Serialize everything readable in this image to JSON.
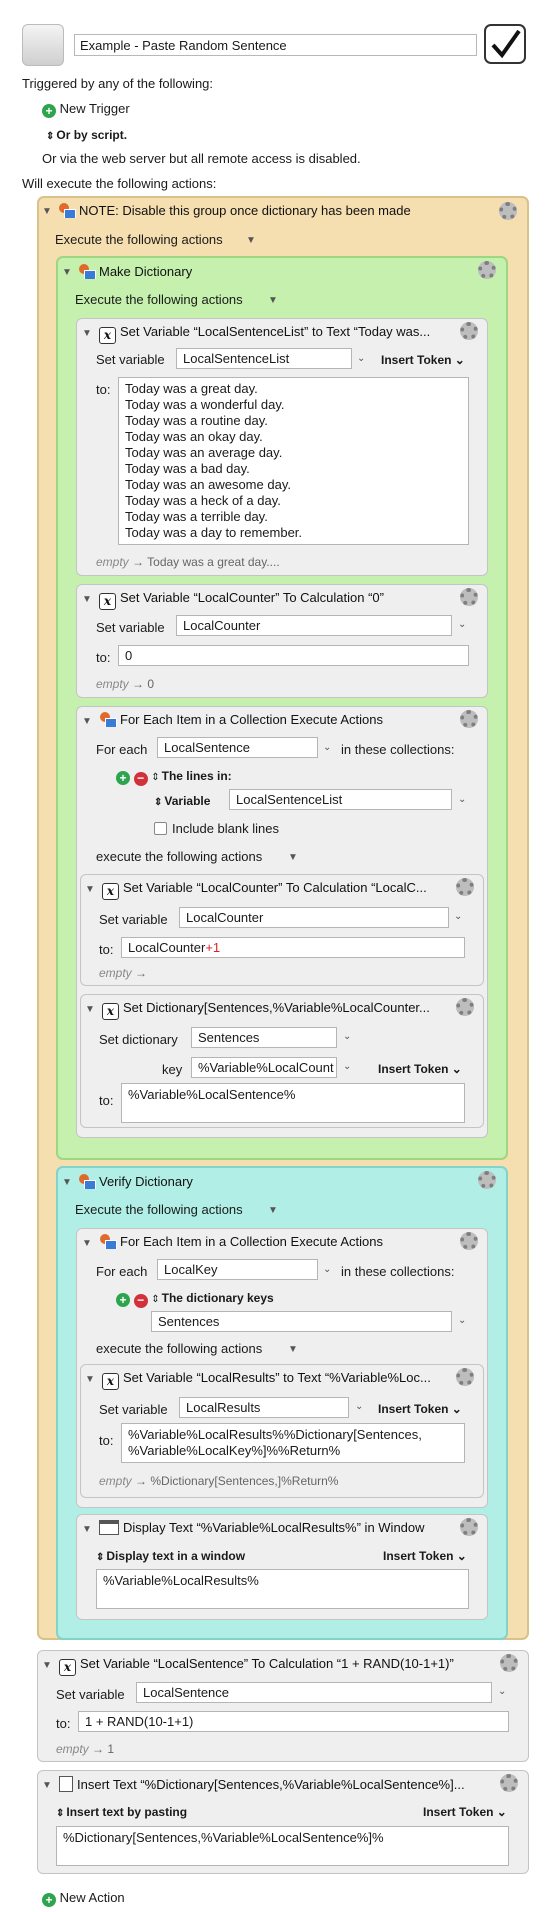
{
  "macro": {
    "name": "Example - Paste Random Sentence",
    "triggered_by": "Triggered by any of the following:",
    "new_trigger": "New Trigger",
    "or_by_script": "Or by script.",
    "web_server": "Or via the web server but all remote access is disabled.",
    "will_execute": "Will execute the following actions:",
    "new_action": "New Action"
  },
  "groups": {
    "note": {
      "title": "NOTE: Disable this group once dictionary has been made",
      "exec": "Execute the following actions"
    },
    "make": {
      "title": "Make Dictionary",
      "exec": "Execute the following actions"
    },
    "verify": {
      "title": "Verify Dictionary",
      "exec": "Execute the following actions"
    }
  },
  "actions": {
    "a1": {
      "title": "Set Variable “LocalSentenceList” to Text “Today was...",
      "set_label": "Set variable",
      "var": "LocalSentenceList",
      "token": "Insert Token",
      "to_label": "to:",
      "text": "Today was a great day.\nToday was a wonderful day.\nToday was a routine day.\nToday was an okay day.\nToday was an average day.\nToday was a bad day.\nToday was an awesome day.\nToday was a heck of a day.\nToday was a terrible day.\nToday was a day to remember.",
      "result_empty": "empty",
      "result": "Today was a great day...."
    },
    "a2": {
      "title": "Set Variable “LocalCounter” To Calculation “0”",
      "set_label": "Set variable",
      "var": "LocalCounter",
      "to_label": "to:",
      "value": "0",
      "result_empty": "empty",
      "result": "0"
    },
    "a3": {
      "title": "For Each Item in a Collection Execute Actions",
      "for_each": "For each",
      "var": "LocalSentence",
      "in_collections": "in these collections:",
      "collection": "The lines in:",
      "variable_label": "Variable",
      "variable": "LocalSentenceList",
      "include_blank": "Include blank lines",
      "exec": "execute the following actions"
    },
    "a4": {
      "title": "Set Variable “LocalCounter” To Calculation “LocalC...",
      "set_label": "Set variable",
      "var": "LocalCounter",
      "to_label": "to:",
      "value": "LocalCounter",
      "value_red": "+1",
      "result_empty": "empty"
    },
    "a5": {
      "title": "Set Dictionary[Sentences,%Variable%LocalCounter...",
      "set_label": "Set dictionary",
      "dict": "Sentences",
      "key_label": "key",
      "key": "%Variable%LocalCount",
      "token": "Insert Token",
      "to_label": "to:",
      "value": "%Variable%LocalSentence%"
    },
    "v1": {
      "title": "For Each Item in a Collection Execute Actions",
      "for_each": "For each",
      "var": "LocalKey",
      "in_collections": "in these collections:",
      "collection": "The dictionary keys",
      "dict": "Sentences",
      "exec": "execute the following actions"
    },
    "v2": {
      "title": "Set Variable “LocalResults” to Text “%Variable%Loc...",
      "set_label": "Set variable",
      "var": "LocalResults",
      "token": "Insert Token",
      "to_label": "to:",
      "text": "%Variable%LocalResults%%Dictionary[Sentences,\n%Variable%LocalKey%]%%Return%",
      "result_empty": "empty",
      "result": "%Dictionary[Sentences,]%Return%"
    },
    "v3": {
      "title": "Display Text “%Variable%LocalResults%” in Window",
      "mode": "Display text in a window",
      "token": "Insert Token",
      "text": "%Variable%LocalResults%"
    },
    "b1": {
      "title": "Set Variable “LocalSentence” To Calculation “1 + RAND(10-1+1)”",
      "set_label": "Set variable",
      "var": "LocalSentence",
      "to_label": "to:",
      "value": "1 + RAND(10-1+1)",
      "result_empty": "empty",
      "result": "1"
    },
    "b2": {
      "title": "Insert Text “%Dictionary[Sentences,%Variable%LocalSentence%]...",
      "mode": "Insert text by pasting",
      "token": "Insert Token",
      "text": "%Dictionary[Sentences,%Variable%LocalSentence%]%"
    }
  },
  "icons": [
    "macro-icon",
    "checkmark-icon",
    "plus-icon",
    "minus-icon",
    "gear-icon",
    "variable-x-icon",
    "group-icon",
    "window-icon",
    "text-icon",
    "disclosure-triangle-icon",
    "chevron-down-icon",
    "arrow-right-icon"
  ]
}
